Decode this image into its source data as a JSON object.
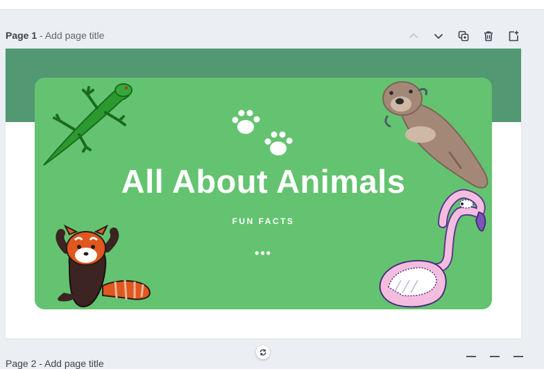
{
  "page": {
    "label": "Page 1",
    "separator": " - ",
    "add_title": "Add page title"
  },
  "actions": [
    {
      "icon": "chevron-up-icon"
    },
    {
      "icon": "chevron-down-icon"
    },
    {
      "icon": "duplicate-icon"
    },
    {
      "icon": "trash-icon"
    },
    {
      "icon": "add-page-icon"
    }
  ],
  "design": {
    "title": "All About Animals",
    "subtitle": "FUN FACTS",
    "dots": "•••"
  },
  "next_page": {
    "label": "Page 2 - Add page title"
  },
  "colors": {
    "background": "#ebeef2",
    "band": "#529873",
    "card": "#64c370"
  }
}
